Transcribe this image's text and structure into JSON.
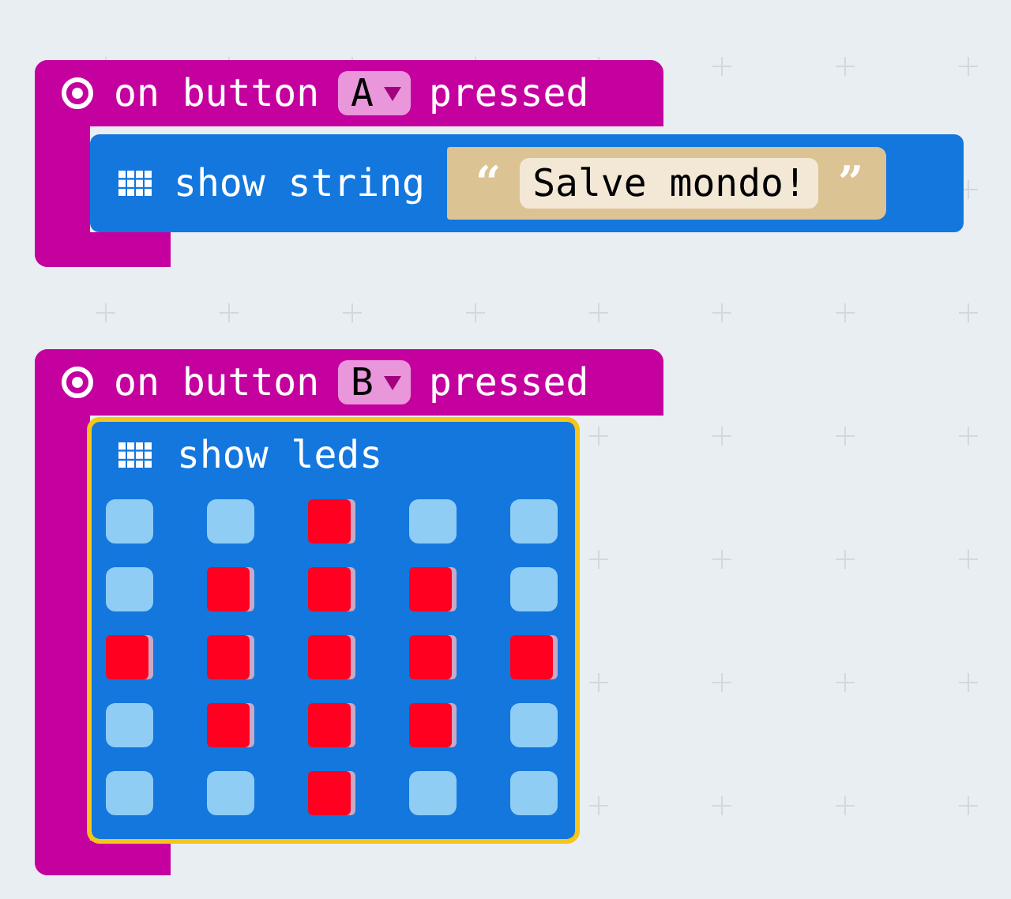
{
  "events": [
    {
      "label_before": "on button",
      "button": "A",
      "label_after": "pressed",
      "statement": {
        "kind": "show_string",
        "label": "show string",
        "open_quote": "“",
        "value": "Salve mondo!",
        "close_quote": "”",
        "selected": false
      }
    },
    {
      "label_before": "on button",
      "button": "B",
      "label_after": "pressed",
      "statement": {
        "kind": "show_leds",
        "label": "show leds",
        "selected": true,
        "leds": [
          [
            false,
            false,
            true,
            false,
            false
          ],
          [
            false,
            true,
            true,
            true,
            false
          ],
          [
            true,
            true,
            true,
            true,
            true
          ],
          [
            false,
            true,
            true,
            true,
            false
          ],
          [
            false,
            false,
            true,
            false,
            false
          ]
        ]
      }
    }
  ]
}
